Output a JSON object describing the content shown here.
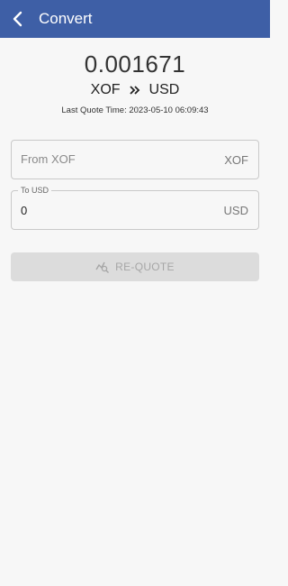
{
  "appbar": {
    "title": "Convert",
    "back_icon": "chevron-left-icon",
    "background": "#3e5fa6"
  },
  "quote": {
    "rate": "0.001671",
    "from_currency": "XOF",
    "to_currency": "USD",
    "separator_icon": "double-chevron-right-icon",
    "last_quote_time": "Last Quote Time: 2023-05-10 06:09:43"
  },
  "from_field": {
    "placeholder": "From XOF",
    "value": "",
    "suffix": "XOF"
  },
  "to_field": {
    "label": "To USD",
    "value": "0",
    "suffix": "USD"
  },
  "requote_button": {
    "label": "RE-QUOTE",
    "icon": "chart-search-icon",
    "enabled": false
  }
}
